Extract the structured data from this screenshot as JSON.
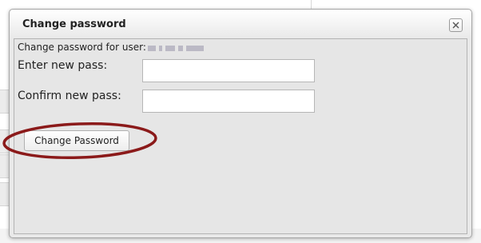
{
  "dialog": {
    "title": "Change password",
    "close_icon": "close-icon"
  },
  "form": {
    "user_prefix": "Change password for user:",
    "new_pass_label": "Enter new pass:",
    "new_pass_value": "",
    "confirm_pass_label": "Confirm new pass:",
    "confirm_pass_value": "",
    "submit_label": "Change Password"
  },
  "annotation": {
    "highlight_color": "#8b1a1a"
  }
}
